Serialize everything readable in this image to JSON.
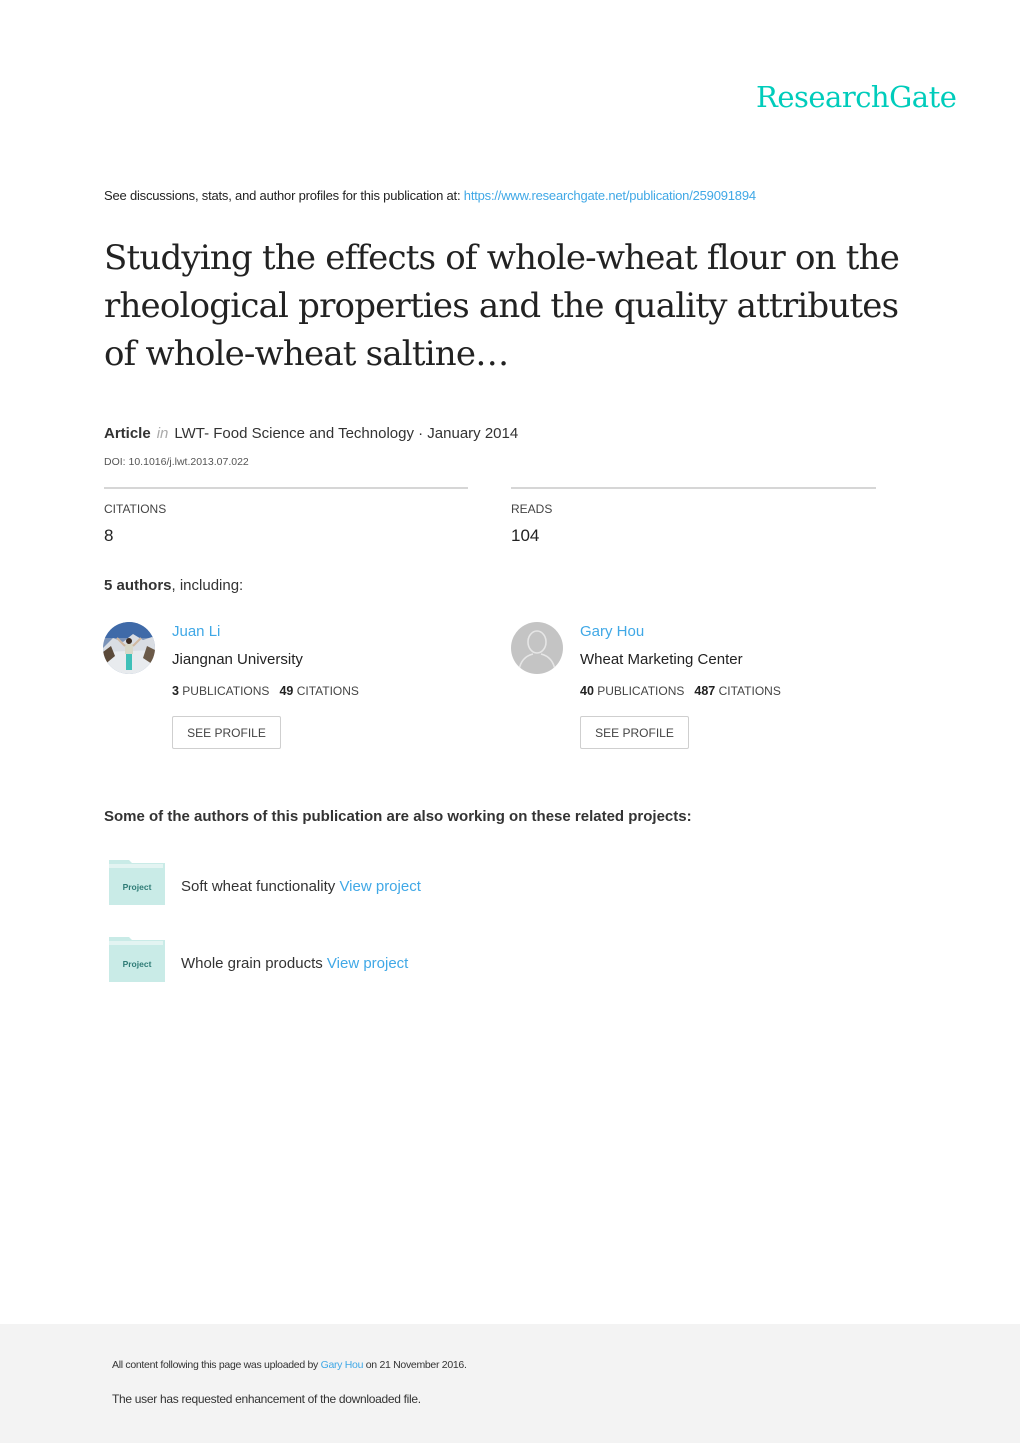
{
  "brand": {
    "logo_text": "ResearchGate",
    "accent": "#00ccbb",
    "link_color": "#40a8e6"
  },
  "header": {
    "see_discussions": "See discussions, stats, and author profiles for this publication at: ",
    "publication_url": "https://www.researchgate.net/publication/259091894"
  },
  "publication": {
    "title": "Studying the effects of whole-wheat flour on the rheological properties and the quality attributes of whole-wheat saltine…",
    "type": "Article",
    "in_label": "in",
    "journal_date": "LWT- Food Science and Technology · January 2014",
    "doi": "DOI: 10.1016/j.lwt.2013.07.022"
  },
  "stats": [
    {
      "label": "CITATIONS",
      "value": "8"
    },
    {
      "label": "READS",
      "value": "104"
    }
  ],
  "authors_summary": {
    "count": "5 authors",
    "suffix": ", including:"
  },
  "authors": [
    {
      "name": "Juan Li",
      "institution": "Jiangnan University",
      "publications": "3",
      "publications_label": "PUBLICATIONS",
      "citations": "49",
      "citations_label": "CITATIONS",
      "button": "SEE PROFILE",
      "avatar": "photo"
    },
    {
      "name": "Gary Hou",
      "institution": "Wheat Marketing Center",
      "publications": "40",
      "publications_label": "PUBLICATIONS",
      "citations": "487",
      "citations_label": "CITATIONS",
      "button": "SEE PROFILE",
      "avatar": "default-user-icon"
    }
  ],
  "related": {
    "heading": "Some of the authors of this publication are also working on these related projects:",
    "projects": [
      {
        "icon_label": "Project",
        "name": "Soft wheat functionality ",
        "link": "View project"
      },
      {
        "icon_label": "Project",
        "name": "Whole grain products ",
        "link": "View project"
      }
    ]
  },
  "footer": {
    "uploaded_prefix": "All content following this page was uploaded by ",
    "uploader": "Gary Hou",
    "uploaded_suffix": " on 21 November 2016.",
    "enhancement": "The user has requested enhancement of the downloaded file."
  }
}
